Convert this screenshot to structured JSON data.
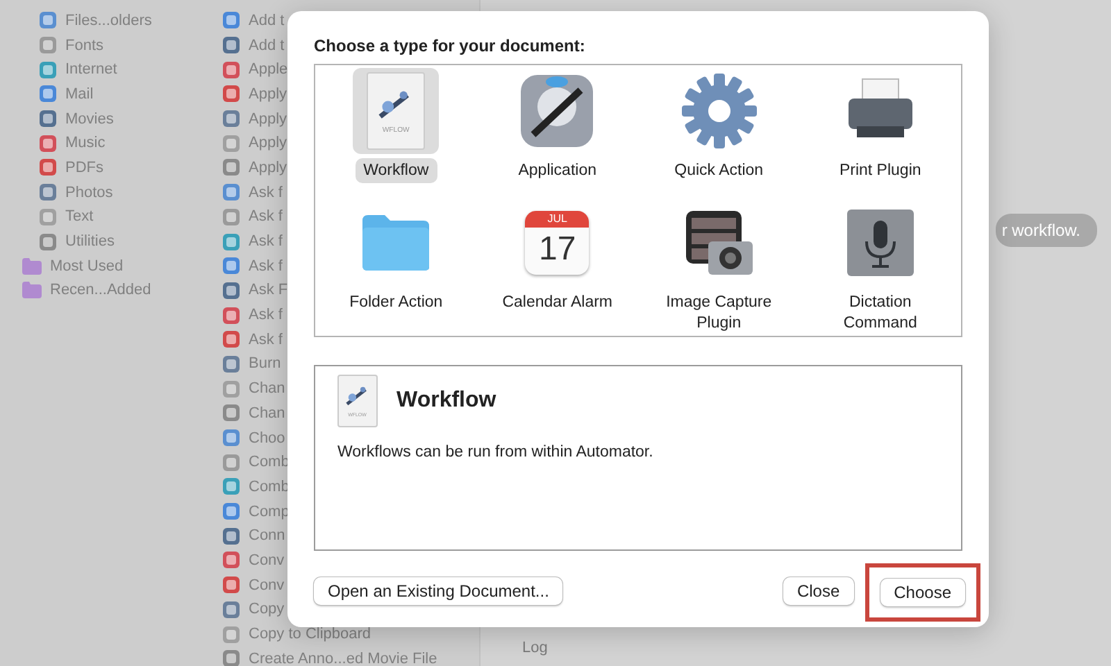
{
  "library": {
    "children": [
      {
        "label": "Files...olders"
      },
      {
        "label": "Fonts"
      },
      {
        "label": "Internet"
      },
      {
        "label": "Mail"
      },
      {
        "label": "Movies"
      },
      {
        "label": "Music"
      },
      {
        "label": "PDFs"
      },
      {
        "label": "Photos"
      },
      {
        "label": "Text"
      },
      {
        "label": "Utilities"
      }
    ]
  },
  "smart_folders": [
    {
      "label": "Most Used"
    },
    {
      "label": "Recen...Added"
    }
  ],
  "actions": [
    {
      "label": "Add t"
    },
    {
      "label": "Add t"
    },
    {
      "label": "Apple"
    },
    {
      "label": "Apply"
    },
    {
      "label": "Apply"
    },
    {
      "label": "Apply"
    },
    {
      "label": "Apply"
    },
    {
      "label": "Ask f"
    },
    {
      "label": "Ask f"
    },
    {
      "label": "Ask f"
    },
    {
      "label": "Ask f"
    },
    {
      "label": "Ask F"
    },
    {
      "label": "Ask f"
    },
    {
      "label": "Ask f"
    },
    {
      "label": "Burn"
    },
    {
      "label": "Chan"
    },
    {
      "label": "Chan"
    },
    {
      "label": "Choo"
    },
    {
      "label": "Comb"
    },
    {
      "label": "Comb"
    },
    {
      "label": "Comp"
    },
    {
      "label": "Conn"
    },
    {
      "label": "Conv"
    },
    {
      "label": "Conv"
    },
    {
      "label": "Copy"
    },
    {
      "label": "Copy to Clipboard"
    },
    {
      "label": "Create Anno...ed Movie File"
    }
  ],
  "workflow_area": {
    "hint": "r workflow.",
    "log_label": "Log"
  },
  "dialog": {
    "title": "Choose a type for your document:",
    "types": [
      {
        "kind": "workflow",
        "label": "Workflow",
        "icon_text": "WFLOW",
        "selected": true
      },
      {
        "kind": "application",
        "label": "Application",
        "selected": false
      },
      {
        "kind": "quick-action",
        "label": "Quick Action",
        "selected": false
      },
      {
        "kind": "print-plugin",
        "label": "Print Plugin",
        "selected": false
      },
      {
        "kind": "folder-action",
        "label": "Folder Action",
        "selected": false
      },
      {
        "kind": "calendar-alarm",
        "label": "Calendar Alarm",
        "icon_month": "JUL",
        "icon_day": "17",
        "selected": false
      },
      {
        "kind": "image-capture",
        "label": "Image Capture Plugin",
        "selected": false
      },
      {
        "kind": "dictation",
        "label": "Dictation Command",
        "selected": false
      }
    ],
    "description": {
      "icon_text": "WFLOW",
      "title": "Workflow",
      "text": "Workflows can be run from within Automator."
    },
    "buttons": [
      {
        "label": "Open an Existing Document...",
        "highlighted": false
      },
      {
        "label": "Close",
        "highlighted": false
      },
      {
        "label": "Choose",
        "highlighted": true
      }
    ]
  }
}
